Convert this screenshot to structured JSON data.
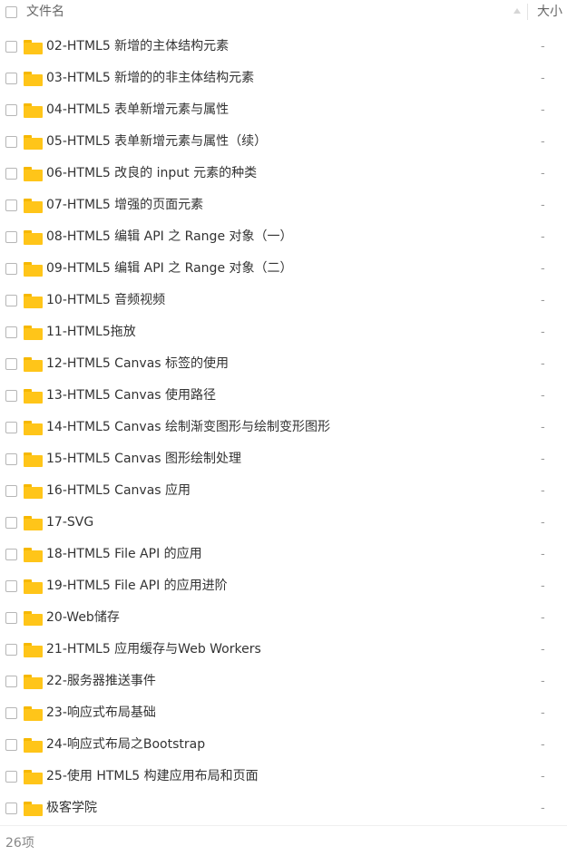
{
  "header": {
    "name_label": "文件名",
    "size_label": "大小"
  },
  "files": [
    {
      "name": "02-HTML5 新增的主体结构元素",
      "size": "-"
    },
    {
      "name": "03-HTML5 新增的的非主体结构元素",
      "size": "-"
    },
    {
      "name": "04-HTML5 表单新增元素与属性",
      "size": "-"
    },
    {
      "name": "05-HTML5 表单新增元素与属性（续）",
      "size": "-"
    },
    {
      "name": "06-HTML5 改良的 input 元素的种类",
      "size": "-"
    },
    {
      "name": "07-HTML5 增强的页面元素",
      "size": "-"
    },
    {
      "name": "08-HTML5 编辑 API 之 Range 对象（一）",
      "size": "-"
    },
    {
      "name": "09-HTML5 编辑 API 之 Range 对象（二）",
      "size": "-"
    },
    {
      "name": "10-HTML5 音频视频",
      "size": "-"
    },
    {
      "name": "11-HTML5拖放",
      "size": "-"
    },
    {
      "name": "12-HTML5 Canvas 标签的使用",
      "size": "-"
    },
    {
      "name": "13-HTML5 Canvas 使用路径",
      "size": "-"
    },
    {
      "name": "14-HTML5 Canvas 绘制渐变图形与绘制变形图形",
      "size": "-"
    },
    {
      "name": "15-HTML5 Canvas 图形绘制处理",
      "size": "-"
    },
    {
      "name": "16-HTML5 Canvas 应用",
      "size": "-"
    },
    {
      "name": "17-SVG",
      "size": "-"
    },
    {
      "name": "18-HTML5 File API 的应用",
      "size": "-"
    },
    {
      "name": "19-HTML5 File API 的应用进阶",
      "size": "-"
    },
    {
      "name": "20-Web储存",
      "size": "-"
    },
    {
      "name": "21-HTML5 应用缓存与Web Workers",
      "size": "-"
    },
    {
      "name": "22-服务器推送事件",
      "size": "-"
    },
    {
      "name": "23-响应式布局基础",
      "size": "-"
    },
    {
      "name": "24-响应式布局之Bootstrap",
      "size": "-"
    },
    {
      "name": "25-使用 HTML5 构建应用布局和页面",
      "size": "-"
    },
    {
      "name": "极客学院",
      "size": "-"
    }
  ],
  "footer": {
    "count_label": "26项"
  },
  "colors": {
    "folder": "#ffc519",
    "folder_tab": "#f6b800",
    "text": "#333333",
    "muted": "#9a9a9a"
  },
  "icons": {
    "folder": "folder-icon",
    "checkbox": "checkbox",
    "sort": "sort-arrow-up-icon"
  }
}
